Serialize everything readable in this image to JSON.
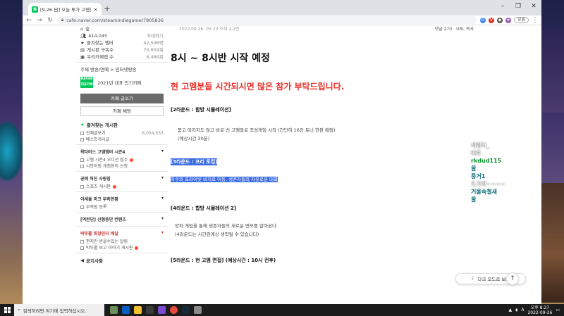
{
  "tab": {
    "title": "[9.26 日] 오늘 투가 고엠현장 : 스",
    "close": "×",
    "new": "+"
  },
  "window_controls": {
    "min": "–",
    "max": "❐",
    "close": "✕"
  },
  "address": {
    "url": "cafe.naver.com/steamindiegame/7805836"
  },
  "profile": {
    "label": "오류"
  },
  "meta": {
    "date": "2022.09.26. 05:23  조회 2,2만",
    "comments": "댓글 270",
    "share": "URL 복사"
  },
  "sidebar": {
    "row_top": "숲",
    "members": {
      "count": "414,045",
      "invite": "초대하기"
    },
    "stats": [
      {
        "label": "즐겨찾는 멤버",
        "value": "42,596명"
      },
      {
        "label": "게시판 구독수",
        "value": "70,659회"
      },
      {
        "label": "우리카페앱 수",
        "value": "6,489회"
      }
    ],
    "topic": "주제  방송/연예 > 인터넷방송",
    "badge_line1": "NAVER",
    "badge_line2": "대표카페",
    "badge_text": "2021년 대표 인기카페",
    "write_button": "카페 글쓰기",
    "chat_button": "카페 채팅",
    "fav_section": "즐겨찾는 게시판",
    "fav_items": [
      {
        "label": "전체글보기",
        "value": "6,054,553"
      },
      {
        "label": "베스트게시글",
        "value": ""
      }
    ],
    "group1": "왁타버스 고멤멤버 시즌4",
    "group1_items": [
      {
        "label": "고멤 시즌4 오디션 접수"
      },
      {
        "label": "시안어링 개최현의 신청"
      }
    ],
    "group2": "공에 허진 사랑짐",
    "group2_items": [
      {
        "label": "스포츠 게시판"
      }
    ],
    "group3": "이세돌 마크 부족현황",
    "group3_items": [
      {
        "label": "부족원 등록"
      }
    ],
    "group4": "[먹린단] 신형종만 컨텐츠",
    "group5": "박뚜뿔 회장인터 배달",
    "group5_items": [
      {
        "label": "편지만 받을수있는 알림"
      },
      {
        "label": "박뚜뿔 보고 이야기 게시판"
      }
    ],
    "notice": "공지사항"
  },
  "article": {
    "title": "8시 ~ 8시반 시작 예정",
    "request": "현 고멤분들 시간되시면 많은 참가 부탁드립니다.",
    "round2_head": "[2라운드 : 합방 시뮬레이션]",
    "round2_line1": "묻고 따지지도 않고 바로 신 고멤들로 조성게임 시작 (간단히 16강 토너 한판 때림)",
    "round2_line2": "(예상시간 30분)",
    "round3_head": "[3라운드 : 프리 토킹]",
    "round3_line": "하쿠의 프라이빗 비치로 이동. 생존자들의 자유로운 대화",
    "round4_head": "[4라운드 : 합방 시뮬레이션 2]",
    "round4_line1": "양파 게임을 통해 생존자들의 새로운 면모를 알아본다.",
    "round4_line2": "(4라운드는 시간관계상 생략될 수 있습니다)",
    "round5_head": "[5라운드 : 현 고멤 면접] (예상시간 : 10시 전후)"
  },
  "chat": [
    "세림다_",
    "바트",
    "rkdud115",
    "꿀",
    "풍거1",
    "드가자~~~~",
    "거울속철새",
    "꿀"
  ],
  "buttons": {
    "darkmode": "다크 모드로 보기",
    "top": "↑"
  },
  "taskbar": {
    "search": "검색하려면 여기에 입력하십시오.",
    "time": "오후 8:27",
    "date": "2022-09-26",
    "lang": "A"
  }
}
